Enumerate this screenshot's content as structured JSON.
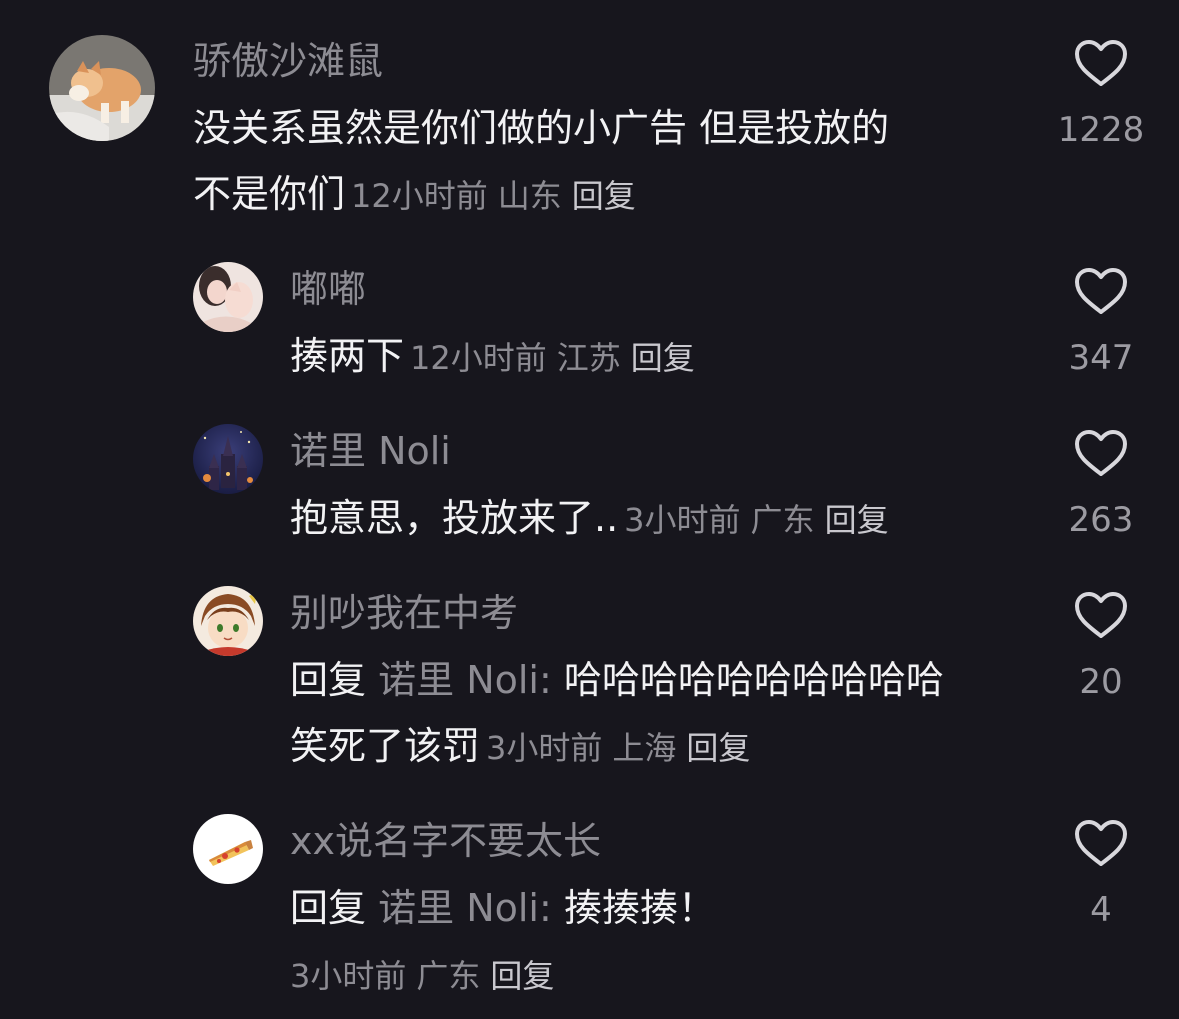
{
  "comments": [
    {
      "username": "骄傲沙滩鼠",
      "text_line1": "没关系虽然是你们做的小广告 但是投放的",
      "text_line2": "不是你们",
      "time": "12小时前",
      "location": "山东",
      "reply_label": "回复",
      "likes": "1228",
      "avatar_icon": "cat-avatar"
    },
    {
      "username": "嘟嘟",
      "text": "揍两下",
      "time": "12小时前",
      "location": "江苏",
      "reply_label": "回复",
      "likes": "347",
      "avatar_icon": "girl-avatar"
    },
    {
      "username": "诺里 Noli",
      "text": "抱意思，投放来了..",
      "time": "3小时前",
      "location": "广东",
      "reply_label": "回复",
      "likes": "263",
      "avatar_icon": "castle-avatar"
    },
    {
      "username": "别吵我在中考",
      "reply_prefix": "回复",
      "reply_target": "诺里 Noli:",
      "text_line1": "哈哈哈哈哈哈哈哈哈哈",
      "text_line2": "笑死了该罚",
      "time": "3小时前",
      "location": "上海",
      "reply_label": "回复",
      "likes": "20",
      "avatar_icon": "anime-avatar"
    },
    {
      "username": "xx说名字不要太长",
      "reply_prefix": "回复",
      "reply_target": "诺里 Noli:",
      "text": "揍揍揍！",
      "time": "3小时前",
      "location": "广东",
      "reply_label": "回复",
      "likes": "4",
      "avatar_icon": "pizza-avatar"
    }
  ],
  "colors": {
    "background": "#17161d",
    "primary_text": "#f2f2f4",
    "secondary_text": "#8d8c93"
  }
}
